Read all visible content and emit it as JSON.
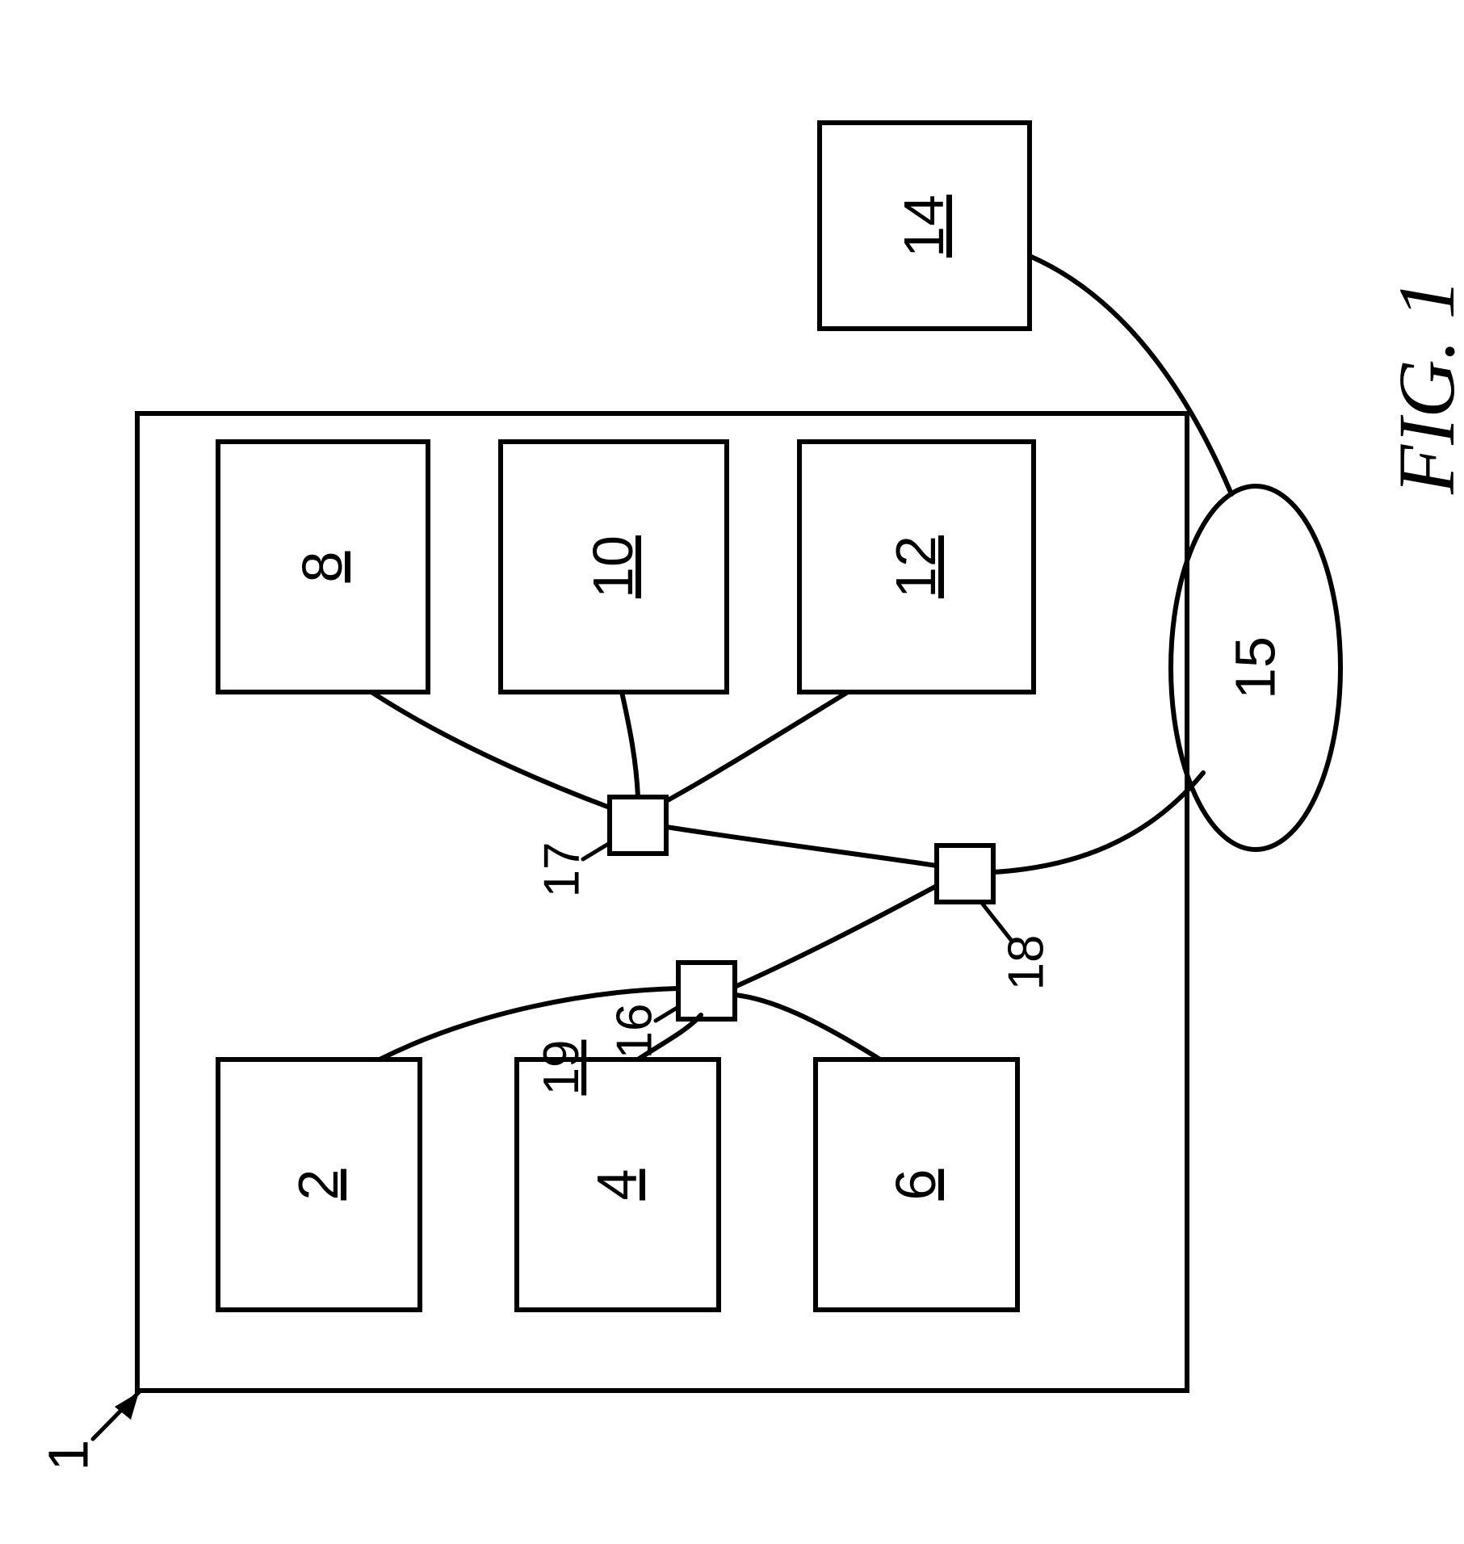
{
  "figure_label": "FIG. 1",
  "outer_pointer": "1",
  "outer_interior": "19",
  "left_blocks": {
    "top": "2",
    "mid": "4",
    "bot": "6"
  },
  "right_blocks": {
    "top": "8",
    "mid": "10",
    "bot": "12"
  },
  "hubs": {
    "left": "16",
    "right": "17",
    "bottom": "18"
  },
  "ellipse": "15",
  "external_block": "14"
}
